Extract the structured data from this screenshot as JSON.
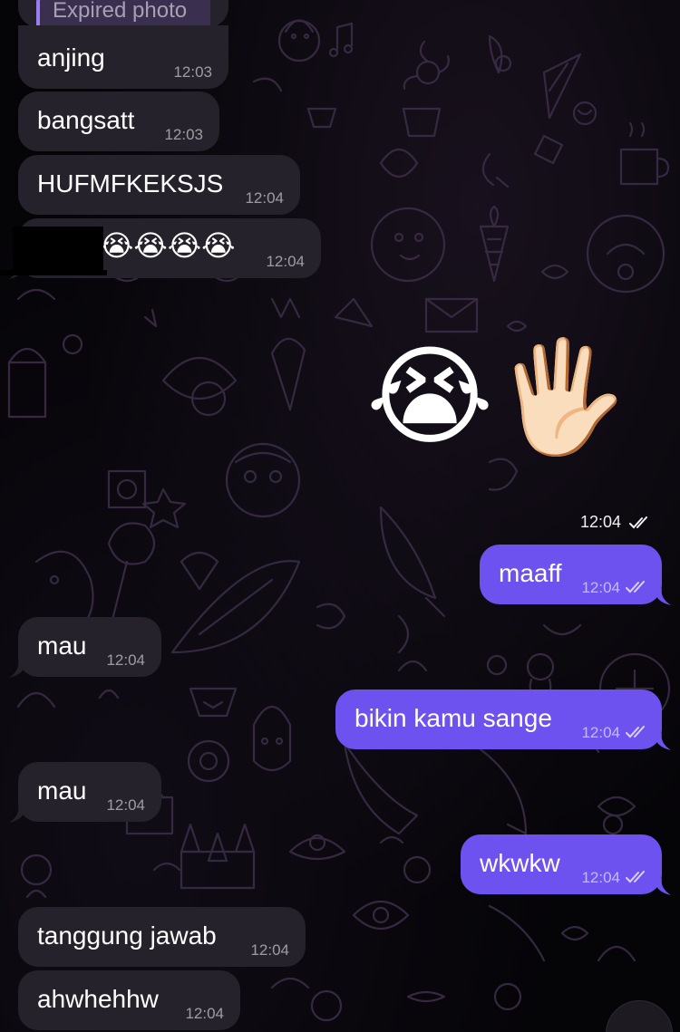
{
  "colors": {
    "incoming_bubble": "#26222b",
    "outgoing_bubble": "#6d52f0",
    "reply_accent": "#9a7ef0",
    "background": "#050407"
  },
  "reply_preview": {
    "label": "Expired photo"
  },
  "messages": [
    {
      "direction": "in",
      "text": "anjing",
      "time": "12:03"
    },
    {
      "direction": "in",
      "text": "bangsatt",
      "time": "12:03"
    },
    {
      "direction": "in",
      "text": "HUFMFKEKSJS",
      "time": "12:04"
    },
    {
      "direction": "in",
      "text": "😭😭😭😭",
      "time": "12:04"
    },
    {
      "direction": "out",
      "text": "😭🖐🏻",
      "time": "12:04",
      "status": "double-check-read"
    },
    {
      "direction": "out",
      "text": "maaff",
      "time": "12:04",
      "status": "double-check-read"
    },
    {
      "direction": "in",
      "text": "mau",
      "time": "12:04"
    },
    {
      "direction": "out",
      "text": "bikin kamu sange",
      "time": "12:04",
      "status": "double-check-read"
    },
    {
      "direction": "in",
      "text": "mau",
      "time": "12:04"
    },
    {
      "direction": "out",
      "text": "wkwkw",
      "time": "12:04",
      "status": "double-check-read"
    },
    {
      "direction": "in",
      "text": "tanggung jawab",
      "time": "12:04"
    },
    {
      "direction": "in",
      "text": "ahwhehhw",
      "time": "12:04"
    }
  ]
}
